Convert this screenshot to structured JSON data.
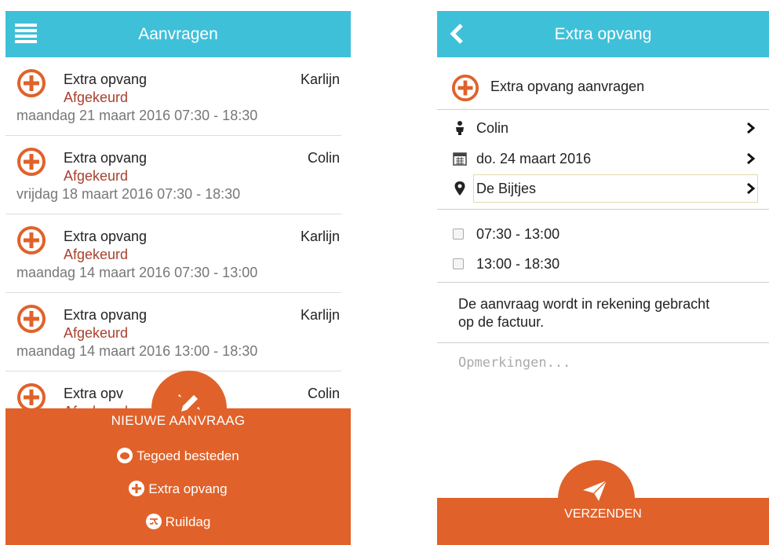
{
  "left": {
    "title": "Aanvragen",
    "items": [
      {
        "type": "Extra opvang",
        "status": "Afgekeurd",
        "name": "Karlijn",
        "date": "maandag 21 maart 2016 07:30 - 18:30"
      },
      {
        "type": "Extra opvang",
        "status": "Afgekeurd",
        "name": "Colin",
        "date": "vrijdag 18 maart 2016 07:30 - 18:30"
      },
      {
        "type": "Extra opvang",
        "status": "Afgekeurd",
        "name": "Karlijn",
        "date": "maandag 14 maart 2016 07:30 - 13:00"
      },
      {
        "type": "Extra opvang",
        "status": "Afgekeurd",
        "name": "Karlijn",
        "date": "maandag 14 maart 2016 13:00 - 18:30"
      },
      {
        "type": "Extra opv",
        "status": "Afgekeurd",
        "name": "Colin",
        "date": ""
      }
    ],
    "panel": {
      "heading": "NIEUWE AANVRAAG",
      "actions": [
        "Tegoed besteden",
        "Extra opvang",
        "Ruildag"
      ]
    }
  },
  "right": {
    "title": "Extra opvang",
    "request_label": "Extra opvang aanvragen",
    "child": "Colin",
    "date": "do. 24 maart 2016",
    "location": "De Bijtjes",
    "slots": [
      "07:30 - 13:00",
      "13:00 - 18:30"
    ],
    "notice_line1": "De aanvraag wordt in rekening gebracht",
    "notice_line2": "op de factuur.",
    "remarks_placeholder": "Opmerkingen...",
    "send_label": "VERZENDEN"
  },
  "colors": {
    "header": "#3fc0d9",
    "accent": "#e0622a",
    "declined": "#a8412e"
  }
}
